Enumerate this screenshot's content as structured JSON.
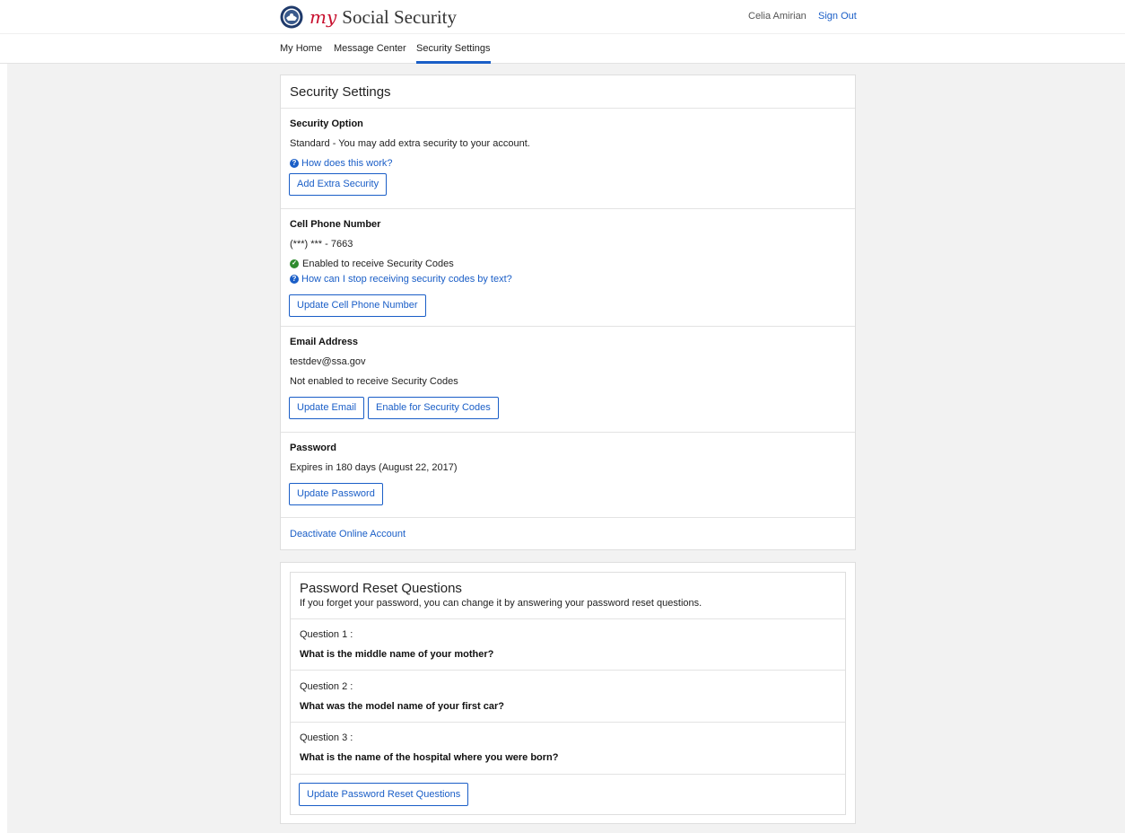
{
  "header": {
    "logo_my": "my",
    "logo_text": "Social Security",
    "user_name": "Celia Amirian",
    "sign_out": "Sign Out"
  },
  "nav": {
    "items": [
      "My Home",
      "Message Center",
      "Security Settings"
    ],
    "active": "Security Settings"
  },
  "security": {
    "title": "Security Settings",
    "option": {
      "label": "Security Option",
      "value": "Standard - You may add extra security to your account.",
      "help": "How does this work?",
      "button": "Add Extra Security"
    },
    "phone": {
      "label": "Cell Phone Number",
      "value": "(***) *** - 7663",
      "status": "Enabled to receive Security Codes",
      "help": "How can I stop receiving security codes by text?",
      "button": "Update Cell Phone Number"
    },
    "email": {
      "label": "Email Address",
      "value": "testdev@ssa.gov",
      "status": "Not enabled to receive Security Codes",
      "update_button": "Update Email",
      "enable_button": "Enable for Security Codes"
    },
    "password": {
      "label": "Password",
      "value": "Expires in 180 days (August 22, 2017)",
      "button": "Update Password"
    },
    "deactivate": "Deactivate Online Account"
  },
  "reset_questions": {
    "title": "Password Reset Questions",
    "subtitle": "If you forget your password, you can change it by answering your password reset questions.",
    "questions": [
      {
        "label": "Question  1 :",
        "text": "What is the middle name of your mother?"
      },
      {
        "label": "Question  2 :",
        "text": "What was the model name of your first car?"
      },
      {
        "label": "Question  3 :",
        "text": "What is the name of the hospital where you were born?"
      }
    ],
    "button": "Update Password Reset Questions"
  },
  "colors": {
    "link": "#1a5ec7",
    "success": "#2e8b2e",
    "brand_red": "#c8102e",
    "background": "#f2f2f2"
  },
  "icons": {
    "seal": "ssa-seal-icon",
    "help": "question-circle-icon",
    "status": "check-circle-icon"
  }
}
